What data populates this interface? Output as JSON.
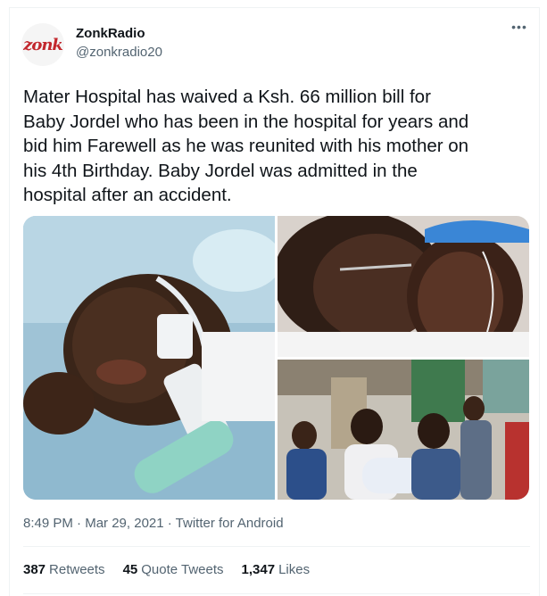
{
  "author": {
    "display_name": "ZonkRadio",
    "handle": "@zonkradio20",
    "avatar_logo_text": "zonk"
  },
  "more_icon": "more-horizontal-icon",
  "tweet": {
    "text_lines": [
      "Mater Hospital has waived a Ksh. 66 million bill for",
      "Baby Jordel who has been in the hospital for years and",
      "bid him Farewell as he was reunited with his mother on",
      "his 4th Birthday. Baby Jordel was admitted in the",
      "hospital after an accident."
    ]
  },
  "timestamp": {
    "time": "8:49 PM",
    "separator": " · ",
    "date": "Mar 29, 2021",
    "client": "Twitter for Android"
  },
  "stats": {
    "retweets_count": "387",
    "retweets_label": "Retweets",
    "quotes_count": "45",
    "quotes_label": "Quote Tweets",
    "likes_count": "1,347",
    "likes_label": "Likes"
  },
  "colors": {
    "text_primary": "#0f1419",
    "text_secondary": "#536471",
    "divider": "#eff3f4",
    "logo_red": "#c2272d"
  }
}
